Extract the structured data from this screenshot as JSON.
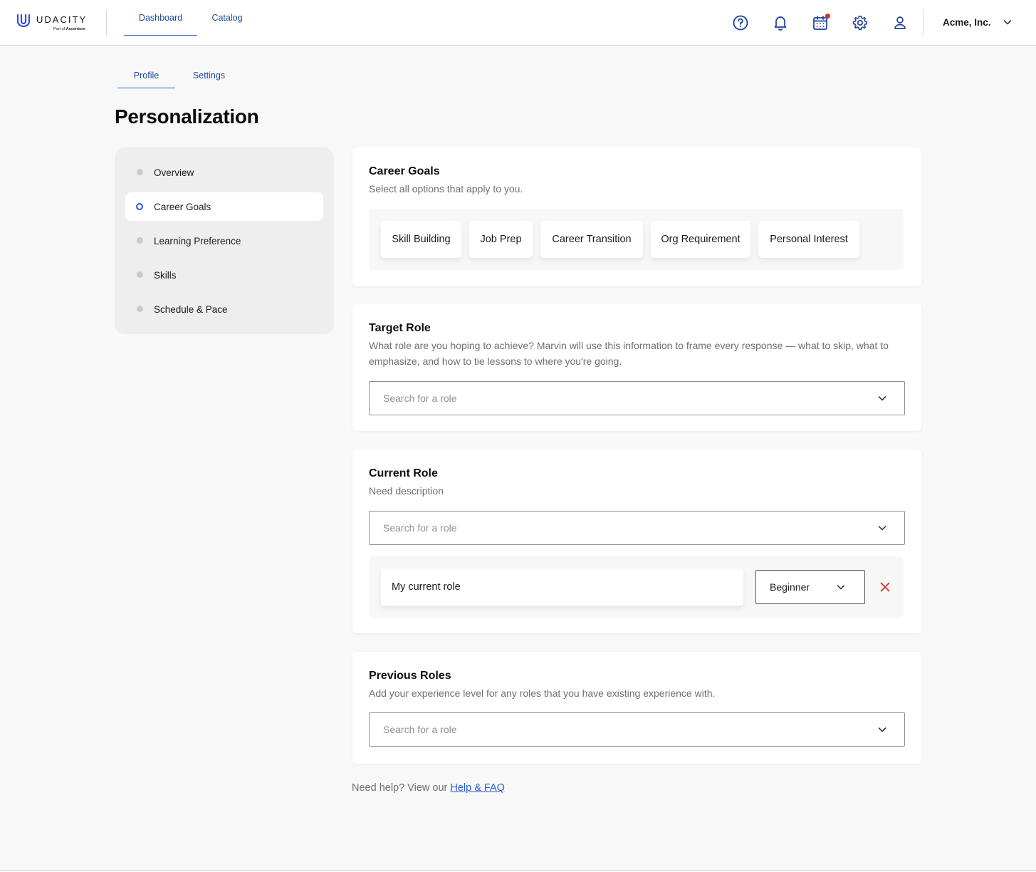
{
  "brand": {
    "name": "UDACITY",
    "tagline_prefix": "Part of",
    "tagline_company": "Accenture",
    "accent": "#2b5bd3",
    "logo_color": "#3d4bd6"
  },
  "nav": {
    "tabs": [
      {
        "label": "Dashboard",
        "active": true
      },
      {
        "label": "Catalog",
        "active": false
      }
    ],
    "icons": [
      "help-circle-icon",
      "bell-icon",
      "calendar-icon",
      "gear-icon",
      "user-icon"
    ],
    "org_name": "Acme, Inc."
  },
  "subtabs": [
    {
      "label": "Profile",
      "active": true
    },
    {
      "label": "Settings",
      "active": false
    }
  ],
  "page_title": "Personalization",
  "sidebar": {
    "items": [
      {
        "label": "Overview",
        "active": false
      },
      {
        "label": "Career Goals",
        "active": true
      },
      {
        "label": "Learning Preference",
        "active": false
      },
      {
        "label": "Skills",
        "active": false
      },
      {
        "label": "Schedule & Pace",
        "active": false
      }
    ]
  },
  "career_goals": {
    "title": "Career Goals",
    "description": "Select all options that apply to you.",
    "options": [
      "Skill Building",
      "Job Prep",
      "Career Transition",
      "Org Requirement",
      "Personal Interest"
    ]
  },
  "target_role": {
    "title": "Target Role",
    "description": "What role are you hoping to achieve? Marvin will use this information to frame every response — what to skip, what to emphasize, and how to tie lessons to where you're going.",
    "placeholder": "Search for a role"
  },
  "current_role": {
    "title": "Current Role",
    "description": "Need description",
    "placeholder": "Search for a role",
    "entry": {
      "name": "My current role",
      "level": "Beginner"
    }
  },
  "previous_roles": {
    "title": "Previous Roles",
    "description": "Add your experience level for any roles that you have existing experience with.",
    "placeholder": "Search for a role"
  },
  "help": {
    "text": "Need help? View our",
    "link": "Help & FAQ"
  }
}
